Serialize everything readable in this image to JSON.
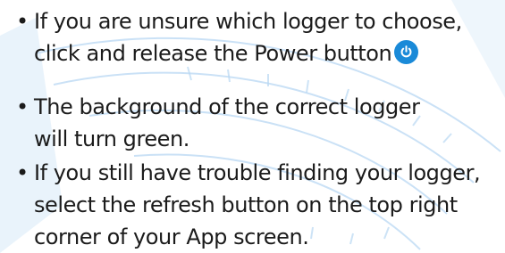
{
  "bullets": [
    {
      "lines": [
        "If you are unsure which logger to choose,",
        "click and release the Power button"
      ],
      "icon": "power-icon"
    },
    {
      "lines": [
        "The background of the correct logger",
        "will turn green."
      ]
    },
    {
      "lines": [
        "If you still have trouble finding your logger,",
        "select the refresh button on the top right",
        "corner of your App screen."
      ]
    }
  ],
  "bullet_glyph": "•",
  "colors": {
    "text": "#1b1b1b",
    "icon_blue": "#1a8ad8",
    "decor_blue": "#b9d8f3"
  }
}
